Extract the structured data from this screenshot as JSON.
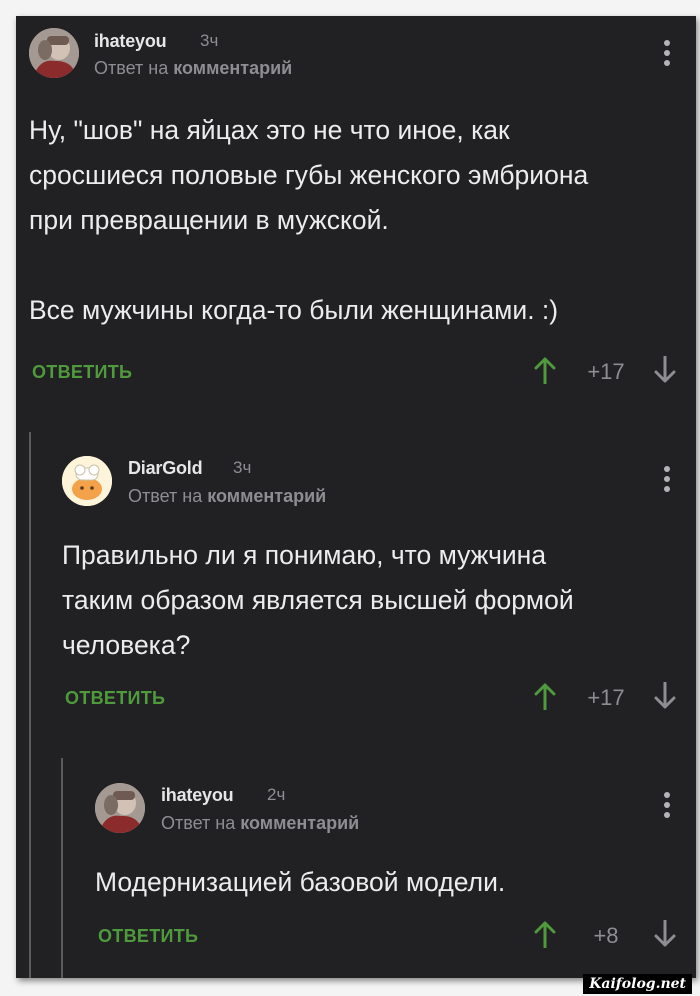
{
  "comments": [
    {
      "username": "ihateyou",
      "time": "3ч",
      "reply_prefix": "Ответ на",
      "reply_target": "комментарий",
      "text": "Ну, \"шов\" на яйцах это не что иное, как\nсросшиеся половые губы женского эмбриона\nпри превращении в мужской.\n\nВсе мужчины когда-то были женщинами. :)",
      "reply_label": "ОТВЕТИТЬ",
      "score": "+17"
    },
    {
      "username": "DiarGold",
      "time": "3ч",
      "reply_prefix": "Ответ на",
      "reply_target": "комментарий",
      "text": "Правильно ли я понимаю, что мужчина\nтаким образом является высшей формой\nчеловека?",
      "reply_label": "ОТВЕТИТЬ",
      "score": "+17"
    },
    {
      "username": "ihateyou",
      "time": "2ч",
      "reply_prefix": "Ответ на",
      "reply_target": "комментарий",
      "text": "Модернизацией базовой модели.",
      "reply_label": "ОТВЕТИТЬ",
      "score": "+8"
    }
  ],
  "watermark": "Kaifolog.net",
  "colors": {
    "background": "#212124",
    "accent_green": "#4f9a3c",
    "muted": "#8d8d92"
  },
  "icons": {
    "upvote": "arrow-up-icon",
    "downvote": "arrow-down-icon",
    "menu": "more-vertical-icon"
  }
}
